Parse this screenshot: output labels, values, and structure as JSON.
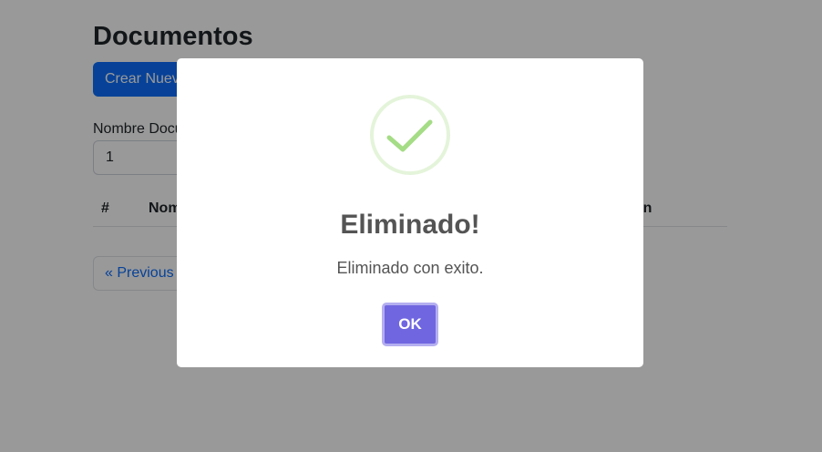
{
  "page": {
    "title": "Documentos",
    "create_button": "Crear Nuevo",
    "filter": {
      "label": "Nombre Documento",
      "value": "1"
    },
    "table": {
      "headers": [
        "#",
        "Nombre",
        "Acción"
      ]
    },
    "pagination": {
      "previous": "« Previous"
    }
  },
  "modal": {
    "icon": "success-check-icon",
    "title": "Eliminado!",
    "message": "Eliminado con exito.",
    "ok_label": "OK",
    "colors": {
      "confirm": "#7066e0",
      "check": "#a5dc86"
    }
  }
}
